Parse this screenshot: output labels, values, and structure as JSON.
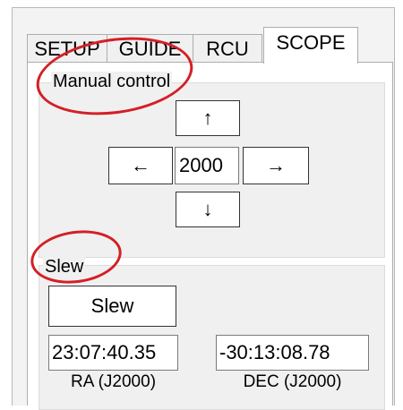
{
  "tabs": [
    {
      "label": "SETUP",
      "active": false
    },
    {
      "label": "GUIDE",
      "active": false
    },
    {
      "label": "RCU",
      "active": false
    },
    {
      "label": "SCOPE",
      "active": true
    }
  ],
  "manual_control": {
    "title": "Manual control",
    "up_label": "↑",
    "down_label": "↓",
    "left_label": "←",
    "right_label": "→",
    "rate_value": "2000"
  },
  "slew": {
    "title": "Slew",
    "button_label": "Slew",
    "ra_value": "23:07:40.35",
    "ra_caption": "RA (J2000)",
    "dec_value": "-30:13:08.78",
    "dec_caption": "DEC (J2000)"
  },
  "colors": {
    "annotation": "#d41f26",
    "panel_bg": "#f0f0f0",
    "tab_border": "#adadad"
  }
}
